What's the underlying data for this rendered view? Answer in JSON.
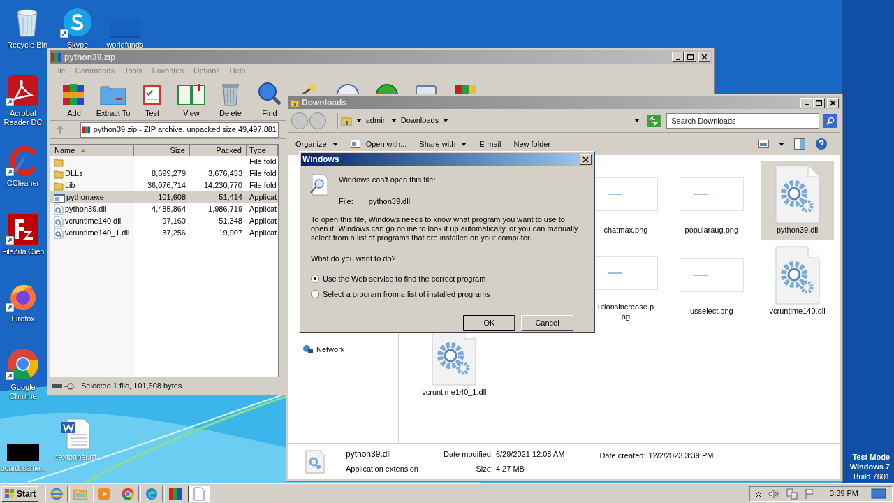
{
  "desktop": {
    "icons": [
      {
        "kind": "recycle",
        "label": "Recycle Bin"
      },
      {
        "kind": "skype",
        "label": "Skype"
      },
      {
        "kind": "blank",
        "label": "worldfunds"
      },
      {
        "kind": "acrobat",
        "label": "Acrobat Reader DC"
      },
      {
        "kind": "ccleaner",
        "label": "CCleaner"
      },
      {
        "kind": "filezilla",
        "label": "FileZilla Clien"
      },
      {
        "kind": "firefox",
        "label": "Firefox"
      },
      {
        "kind": "chrome",
        "label": "Google Chrome"
      },
      {
        "kind": "black",
        "label": "boardssame..."
      },
      {
        "kind": "word",
        "label": "textpanel.rtf"
      }
    ],
    "watermark": [
      "Test Mode",
      "Windows 7",
      "Build 7601"
    ]
  },
  "winrar": {
    "title": "python39.zip",
    "menu": [
      "File",
      "Commands",
      "Tools",
      "Favorites",
      "Options",
      "Help"
    ],
    "toolbar": [
      {
        "kind": "add",
        "label": "Add"
      },
      {
        "kind": "extract",
        "label": "Extract To"
      },
      {
        "kind": "test",
        "label": "Test"
      },
      {
        "kind": "view",
        "label": "View"
      },
      {
        "kind": "delete",
        "label": "Delete"
      },
      {
        "kind": "find",
        "label": "Find"
      },
      {
        "kind": "wizard"
      },
      {
        "kind": "info"
      },
      {
        "kind": "virus"
      },
      {
        "kind": "comment"
      },
      {
        "kind": "sfx"
      }
    ],
    "address": "python39.zip - ZIP archive, unpacked size 49,497,881",
    "columns": [
      "Name",
      "Size",
      "Packed",
      "Type"
    ],
    "rows": [
      {
        "kind": "folder",
        "name": "..",
        "type": "File fold",
        "selected": false
      },
      {
        "kind": "folder",
        "name": "DLLs",
        "size": "8,699,279",
        "packed": "3,676,433",
        "type": "File fold",
        "selected": false
      },
      {
        "kind": "folder",
        "name": "Lib",
        "size": "36,076,714",
        "packed": "14,230,770",
        "type": "File fold",
        "selected": false
      },
      {
        "kind": "exe",
        "name": "python.exe",
        "size": "101,608",
        "packed": "51,414",
        "type": "Applicat",
        "selected": true
      },
      {
        "kind": "dll",
        "name": "python39.dll",
        "size": "4,485,864",
        "packed": "1,986,719",
        "type": "Applicat",
        "selected": false
      },
      {
        "kind": "dll",
        "name": "vcruntime140.dll",
        "size": "97,160",
        "packed": "51,348",
        "type": "Applicat",
        "selected": false
      },
      {
        "kind": "dll",
        "name": "vcruntime140_1.dll",
        "size": "37,256",
        "packed": "19,907",
        "type": "Applicat",
        "selected": false
      }
    ],
    "status": "Selected 1 file, 101,608 bytes"
  },
  "explorer": {
    "title": "Downloads",
    "breadcrumb": [
      "admin",
      "Downloads"
    ],
    "search": {
      "placeholder": "Search Downloads"
    },
    "commands": [
      {
        "label": "Organize",
        "menu": true
      },
      {
        "label": "Open with...",
        "menu": false
      },
      {
        "label": "Share with",
        "menu": true
      },
      {
        "label": "E-mail",
        "menu": false
      },
      {
        "label": "New folder",
        "menu": false
      }
    ],
    "nav": [
      "Network"
    ],
    "file_rows": [
      [
        {
          "name": "chatmax.png",
          "selected": false
        },
        {
          "name": "popularaug.png",
          "selected": false
        },
        {
          "kind": "dll",
          "name": "python39.dll",
          "selected": true
        }
      ],
      [
        {
          "name": "utionsincrease.png",
          "selected": false
        },
        {
          "name": "usselect.png",
          "selected": false
        },
        {
          "kind": "dll",
          "name": "vcruntime140.dll",
          "selected": false
        }
      ],
      [
        {
          "kind": "dll",
          "name": "vcruntime140_1.dll",
          "selected": false
        }
      ]
    ],
    "details": {
      "name": "python39.dll",
      "type": "Application extension",
      "fields": [
        {
          "label": "Date modified:",
          "value": "6/29/2021 12:08 AM"
        },
        {
          "label": "Size:",
          "value": "4.27 MB"
        },
        {
          "label": "Date created:",
          "value": "12/2/2023 3:39 PM"
        }
      ]
    }
  },
  "dialog": {
    "title": "Windows",
    "heading": "Windows can't open this file:",
    "file_label": "File:",
    "file_name": "python39.dll",
    "body": "To open this file, Windows needs to know what program you want to use to open it. Windows can go online to look it up automatically, or you can manually select from a list of programs that are installed on your computer.",
    "question": "What do you want to do?",
    "options": [
      {
        "label": "Use the Web service to find the correct program",
        "selected": true
      },
      {
        "label": "Select a program from a list of installed programs",
        "selected": false
      }
    ],
    "buttons": [
      {
        "label": "OK",
        "default": true
      },
      {
        "label": "Cancel",
        "default": false
      }
    ]
  },
  "taskbar": {
    "start": "Start",
    "apps": [
      {
        "kind": "ie",
        "active": false
      },
      {
        "kind": "folder",
        "active": false
      },
      {
        "kind": "media",
        "active": false
      },
      {
        "kind": "chrome",
        "active": false
      },
      {
        "kind": "edge",
        "active": false
      },
      {
        "kind": "winrar",
        "active": false
      },
      {
        "kind": "document",
        "active": true
      }
    ],
    "time": "3:39 PM"
  }
}
